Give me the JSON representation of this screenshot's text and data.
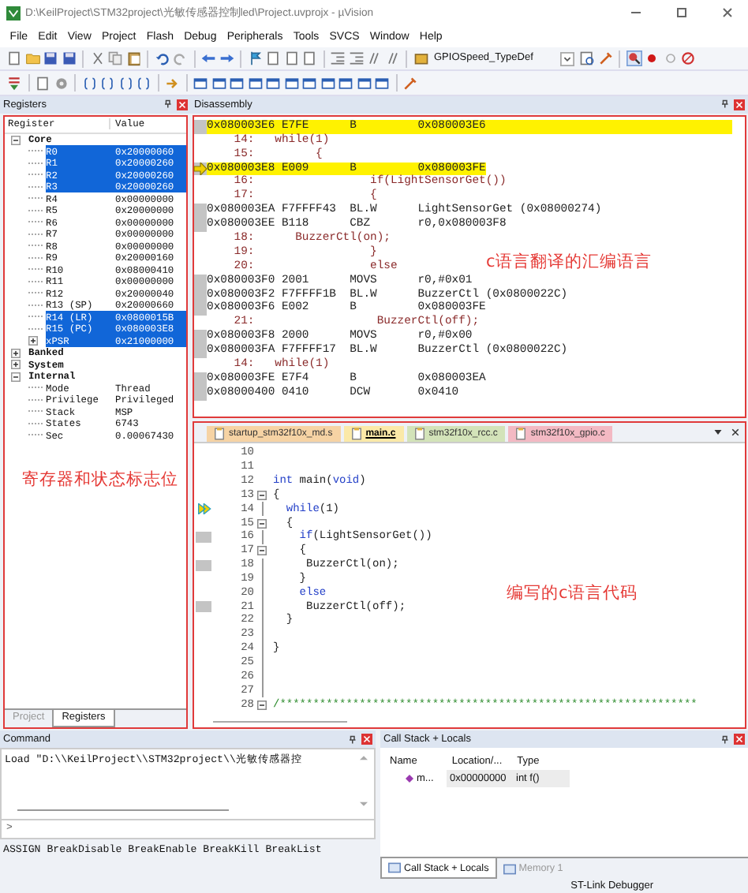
{
  "window": {
    "title": "D:\\KeilProject\\STM32project\\光敏传感器控制led\\Project.uvprojx - µVision"
  },
  "menu": [
    "File",
    "Edit",
    "View",
    "Project",
    "Flash",
    "Debug",
    "Peripherals",
    "Tools",
    "SVCS",
    "Window",
    "Help"
  ],
  "toolbar": {
    "combo_value": "GPIOSpeed_TypeDef"
  },
  "registers": {
    "title": "Registers",
    "columns": [
      "Register",
      "Value"
    ],
    "tree": [
      {
        "name": "Core",
        "selected": false,
        "expanded": true,
        "children": [
          {
            "name": "R0",
            "value": "0x20000060",
            "selected": true
          },
          {
            "name": "R1",
            "value": "0x20000260",
            "selected": true
          },
          {
            "name": "R2",
            "value": "0x20000260",
            "selected": true
          },
          {
            "name": "R3",
            "value": "0x20000260",
            "selected": true
          },
          {
            "name": "R4",
            "value": "0x00000000",
            "selected": false
          },
          {
            "name": "R5",
            "value": "0x20000000",
            "selected": false
          },
          {
            "name": "R6",
            "value": "0x00000000",
            "selected": false
          },
          {
            "name": "R7",
            "value": "0x00000000",
            "selected": false
          },
          {
            "name": "R8",
            "value": "0x00000000",
            "selected": false
          },
          {
            "name": "R9",
            "value": "0x20000160",
            "selected": false
          },
          {
            "name": "R10",
            "value": "0x08000410",
            "selected": false
          },
          {
            "name": "R11",
            "value": "0x00000000",
            "selected": false
          },
          {
            "name": "R12",
            "value": "0x20000040",
            "selected": false
          },
          {
            "name": "R13 (SP)",
            "value": "0x20000660",
            "selected": false
          },
          {
            "name": "R14 (LR)",
            "value": "0x0800015B",
            "selected": true
          },
          {
            "name": "R15 (PC)",
            "value": "0x080003E8",
            "selected": true
          },
          {
            "name": "xPSR",
            "value": "0x21000000",
            "selected": true,
            "expanded": false
          }
        ]
      },
      {
        "name": "Banked",
        "selected": false,
        "expanded": false
      },
      {
        "name": "System",
        "selected": false,
        "expanded": false
      },
      {
        "name": "Internal",
        "selected": false,
        "expanded": true,
        "children": [
          {
            "name": "Mode",
            "value": "Thread",
            "selected": false
          },
          {
            "name": "Privilege",
            "value": "Privileged",
            "selected": false
          },
          {
            "name": "Stack",
            "value": "MSP",
            "selected": false
          },
          {
            "name": "States",
            "value": "6743",
            "selected": false
          },
          {
            "name": "Sec",
            "value": "0.00067430",
            "selected": false
          }
        ]
      }
    ],
    "note": "寄存器和状态标志位",
    "tabs": [
      {
        "label": "Project",
        "selected": false
      },
      {
        "label": "Registers",
        "selected": true
      }
    ]
  },
  "disassembly": {
    "title": "Disassembly",
    "note": "c语言翻译的汇编语言",
    "lines": [
      {
        "kind": "asm",
        "text": "0x080003E6 E7FE      B         0x080003E6",
        "highlighted": true,
        "current": false
      },
      {
        "kind": "src",
        "text": "    14:   while(1)"
      },
      {
        "kind": "src",
        "text": "    15:         {"
      },
      {
        "kind": "asm",
        "text": "0x080003E8 E009      B         0x080003FE",
        "highlighted": true,
        "current": true
      },
      {
        "kind": "src",
        "text": "    16:                 if(LightSensorGet())"
      },
      {
        "kind": "src",
        "text": "    17:                 {"
      },
      {
        "kind": "asm",
        "text": "0x080003EA F7FFFF43  BL.W      LightSensorGet (0x08000274)"
      },
      {
        "kind": "asm",
        "text": "0x080003EE B118      CBZ       r0,0x080003F8"
      },
      {
        "kind": "src",
        "text": "    18:      BuzzerCtl(on);"
      },
      {
        "kind": "src",
        "text": "    19:                 }"
      },
      {
        "kind": "src",
        "text": "    20:                 else"
      },
      {
        "kind": "asm",
        "text": "0x080003F0 2001      MOVS      r0,#0x01"
      },
      {
        "kind": "asm",
        "text": "0x080003F2 F7FFFF1B  BL.W      BuzzerCtl (0x0800022C)"
      },
      {
        "kind": "asm",
        "text": "0x080003F6 E002      B         0x080003FE"
      },
      {
        "kind": "src",
        "text": "    21:                  BuzzerCtl(off);"
      },
      {
        "kind": "asm",
        "text": "0x080003F8 2000      MOVS      r0,#0x00"
      },
      {
        "kind": "asm",
        "text": "0x080003FA F7FFFF17  BL.W      BuzzerCtl (0x0800022C)"
      },
      {
        "kind": "src",
        "text": "    14:   while(1)"
      },
      {
        "kind": "asm",
        "text": "0x080003FE E7F4      B         0x080003EA"
      },
      {
        "kind": "asm",
        "text": "0x08000400 0410      DCW       0x0410"
      }
    ]
  },
  "editor": {
    "note": "编写的c语言代码",
    "tabs": [
      {
        "label": "startup_stm32f10x_md.s",
        "selected": false,
        "color": "#f6d3a4"
      },
      {
        "label": "main.c",
        "selected": true,
        "color": "#fbe9a8"
      },
      {
        "label": "stm32f10x_rcc.c",
        "selected": false,
        "color": "#d3e3b9"
      },
      {
        "label": "stm32f10x_gpio.c",
        "selected": false,
        "color": "#f3b9c3"
      }
    ],
    "lines": [
      {
        "num": "10",
        "fold_start": false,
        "in_fold": false,
        "current": false,
        "has_code": false
      },
      {
        "num": "11",
        "fold_start": false,
        "in_fold": false,
        "current": false,
        "has_code": false
      },
      {
        "num": "12",
        "fold_start": false,
        "in_fold": false,
        "current": false,
        "has_code": false,
        "parts": [
          {
            "kind": "keyword",
            "text": "int"
          },
          {
            "kind": "plain",
            "text": " main("
          },
          {
            "kind": "keyword",
            "text": "void"
          },
          {
            "kind": "plain",
            "text": ")"
          }
        ]
      },
      {
        "num": "13",
        "fold_start": true,
        "in_fold": false,
        "current": false,
        "has_code": false,
        "parts": [
          {
            "kind": "plain",
            "text": "{"
          }
        ]
      },
      {
        "num": "14",
        "fold_start": false,
        "in_fold": true,
        "current": true,
        "has_code": false,
        "parts": [
          {
            "kind": "keyword",
            "text": "  while"
          },
          {
            "kind": "plain",
            "text": "(1)"
          }
        ]
      },
      {
        "num": "15",
        "fold_start": true,
        "in_fold": false,
        "current": false,
        "has_code": false,
        "parts": [
          {
            "kind": "plain",
            "text": "  {"
          }
        ]
      },
      {
        "num": "16",
        "fold_start": false,
        "in_fold": true,
        "current": false,
        "has_code": true,
        "parts": [
          {
            "kind": "keyword",
            "text": "    if"
          },
          {
            "kind": "plain",
            "text": "(LightSensorGet())"
          }
        ]
      },
      {
        "num": "17",
        "fold_start": true,
        "in_fold": false,
        "current": false,
        "has_code": false,
        "parts": [
          {
            "kind": "plain",
            "text": "    {"
          }
        ]
      },
      {
        "num": "18",
        "fold_start": false,
        "in_fold": true,
        "current": false,
        "has_code": true,
        "parts": [
          {
            "kind": "plain",
            "text": "     BuzzerCtl(on);"
          }
        ]
      },
      {
        "num": "19",
        "fold_start": false,
        "in_fold": true,
        "current": false,
        "has_code": false,
        "parts": [
          {
            "kind": "plain",
            "text": "    }"
          }
        ]
      },
      {
        "num": "20",
        "fold_start": false,
        "in_fold": true,
        "current": false,
        "has_code": false,
        "parts": [
          {
            "kind": "keyword",
            "text": "    else"
          }
        ]
      },
      {
        "num": "21",
        "fold_start": false,
        "in_fold": true,
        "current": false,
        "has_code": true,
        "parts": [
          {
            "kind": "plain",
            "text": "     BuzzerCtl(off);"
          }
        ]
      },
      {
        "num": "22",
        "fold_start": false,
        "in_fold": true,
        "current": false,
        "has_code": false,
        "parts": [
          {
            "kind": "plain",
            "text": "  }"
          }
        ]
      },
      {
        "num": "23",
        "fold_start": false,
        "in_fold": true,
        "current": false,
        "has_code": false
      },
      {
        "num": "24",
        "fold_start": false,
        "in_fold": true,
        "current": false,
        "has_code": false,
        "parts": [
          {
            "kind": "plain",
            "text": "}"
          }
        ]
      },
      {
        "num": "25",
        "fold_start": false,
        "in_fold": true,
        "current": false,
        "has_code": false
      },
      {
        "num": "26",
        "fold_start": false,
        "in_fold": true,
        "current": false,
        "has_code": false
      },
      {
        "num": "27",
        "fold_start": false,
        "in_fold": true,
        "current": false,
        "has_code": false
      },
      {
        "num": "28",
        "fold_start": true,
        "in_fold": false,
        "current": false,
        "has_code": false,
        "parts": [
          {
            "kind": "comment",
            "text": "/***************************************************************"
          }
        ]
      }
    ]
  },
  "command": {
    "title": "Command",
    "output": "Load \"D:\\\\KeilProject\\\\STM32project\\\\光敏传感器控",
    "prompt": ">",
    "hint": "ASSIGN BreakDisable BreakEnable BreakKill BreakList"
  },
  "call_stack": {
    "title": "Call Stack + Locals",
    "columns": [
      "Name",
      "Location/...",
      "Type"
    ],
    "rows": [
      {
        "name": "m...",
        "location": "0x00000000",
        "type": "int f()"
      }
    ],
    "tabs": [
      {
        "label": "Call Stack + Locals",
        "selected": true
      },
      {
        "label": "Memory 1",
        "selected": false
      }
    ]
  },
  "status_bar": {
    "text": "ST-Link Debugger"
  }
}
